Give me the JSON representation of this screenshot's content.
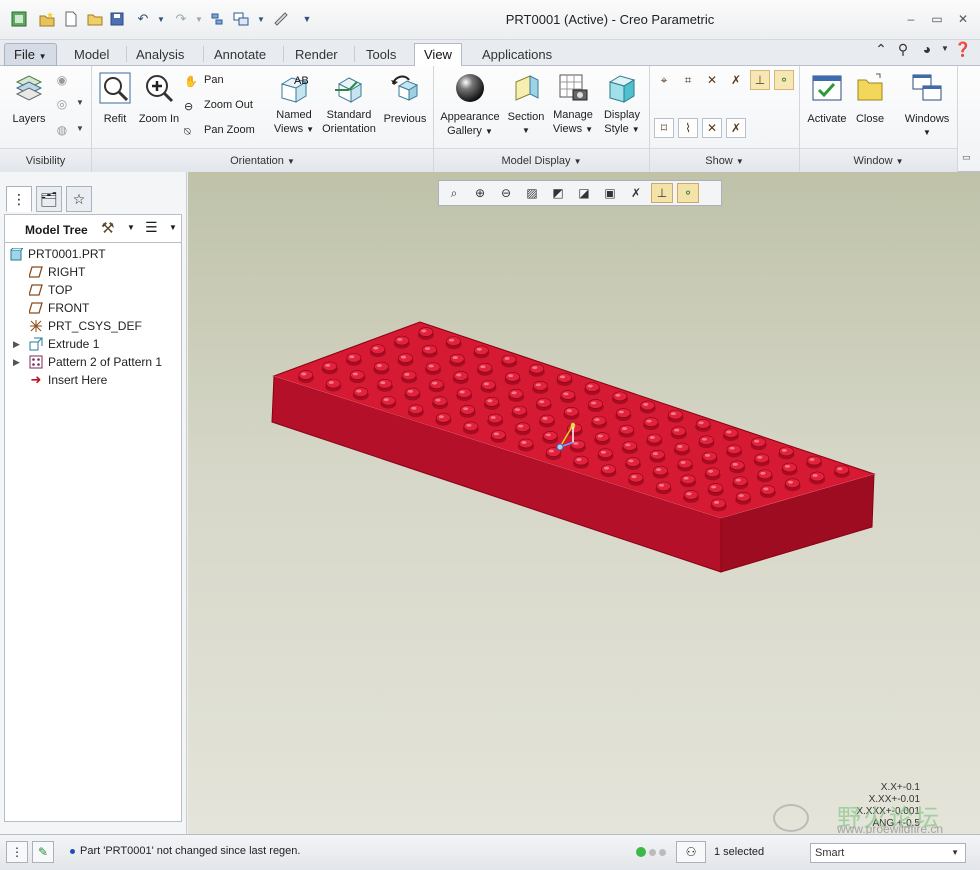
{
  "window": {
    "title": "PRT0001 (Active) - Creo Parametric"
  },
  "tabs": [
    {
      "label": "File",
      "id": "file"
    },
    {
      "label": "Model",
      "id": "model"
    },
    {
      "label": "Analysis",
      "id": "analysis"
    },
    {
      "label": "Annotate",
      "id": "annotate"
    },
    {
      "label": "Render",
      "id": "render"
    },
    {
      "label": "Tools",
      "id": "tools"
    },
    {
      "label": "View",
      "id": "view",
      "active": true
    },
    {
      "label": "Applications",
      "id": "applications"
    }
  ],
  "ribbon": {
    "visibility": {
      "label": "Visibility",
      "layers": "Layers"
    },
    "orientation": {
      "label": "Orientation",
      "refit": "Refit",
      "zoom_in": "Zoom In",
      "pan": "Pan",
      "zoom_out": "Zoom Out",
      "pan_zoom": "Pan Zoom",
      "named_views_1": "Named",
      "named_views_2": "Views",
      "standard_orientation_1": "Standard",
      "standard_orientation_2": "Orientation",
      "previous": "Previous"
    },
    "model_display": {
      "label": "Model Display",
      "appearance_1": "Appearance",
      "appearance_2": "Gallery",
      "section": "Section",
      "manage_views_1": "Manage",
      "manage_views_2": "Views",
      "display_style_1": "Display",
      "display_style_2": "Style"
    },
    "show": {
      "label": "Show"
    },
    "window": {
      "label": "Window",
      "activate": "Activate",
      "close": "Close",
      "windows": "Windows"
    }
  },
  "model_tree": {
    "title": "Model Tree",
    "items": [
      {
        "label": "PRT0001.PRT",
        "icon": "part-icon",
        "level": 0
      },
      {
        "label": "RIGHT",
        "icon": "datum-plane-icon",
        "level": 1
      },
      {
        "label": "TOP",
        "icon": "datum-plane-icon",
        "level": 1
      },
      {
        "label": "FRONT",
        "icon": "datum-plane-icon",
        "level": 1
      },
      {
        "label": "PRT_CSYS_DEF",
        "icon": "csys-icon",
        "level": 1
      },
      {
        "label": "Extrude 1",
        "icon": "extrude-icon",
        "level": 1,
        "expandable": true
      },
      {
        "label": "Pattern 2 of Pattern 1",
        "icon": "pattern-icon",
        "level": 1,
        "expandable": true
      },
      {
        "label": "Insert Here",
        "icon": "insert-arrow-icon",
        "level": 1
      }
    ]
  },
  "viewport": {
    "tolerances": [
      "X.X+-0.1",
      "X.XX+-0.01",
      "X.XXX+-0.001",
      "ANG +-0.5"
    ],
    "watermark": {
      "cn": "野火论坛",
      "url": "www.proewildfire.cn"
    }
  },
  "status": {
    "message": "Part 'PRT0001' not changed since last regen.",
    "selected": "1 selected",
    "filter": "Smart"
  },
  "colors": {
    "model": "#c8102e",
    "accent": "#2f5f9e"
  }
}
